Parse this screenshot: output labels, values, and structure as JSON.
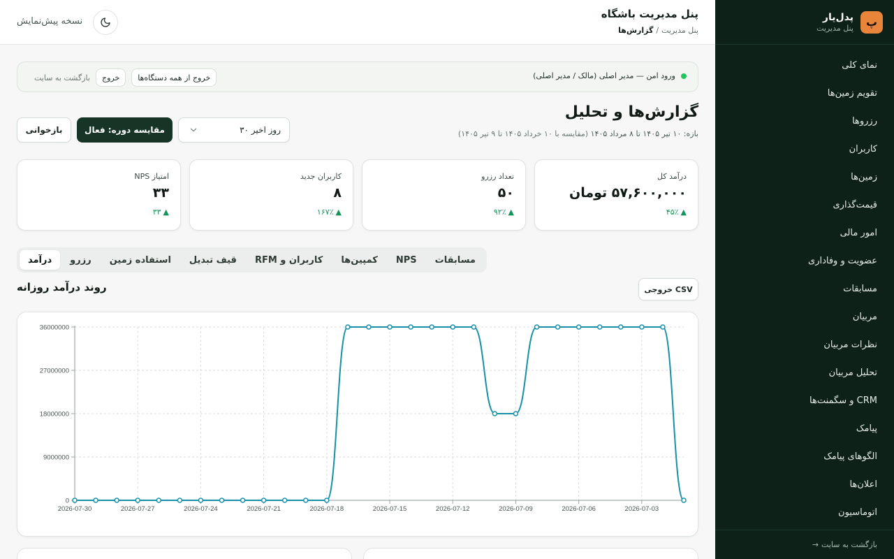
{
  "sidebar": {
    "brand_logo": "پ",
    "brand_title": "پدل‌یار",
    "brand_subtitle": "پنل مدیریت",
    "items": [
      {
        "label": "نمای کلی"
      },
      {
        "label": "تقویم زمین‌ها"
      },
      {
        "label": "رزروها"
      },
      {
        "label": "کاربران"
      },
      {
        "label": "زمین‌ها"
      },
      {
        "label": "قیمت‌گذاری"
      },
      {
        "label": "امور مالی"
      },
      {
        "label": "عضویت و وفاداری"
      },
      {
        "label": "مسابقات"
      },
      {
        "label": "مربیان"
      },
      {
        "label": "نظرات مربیان"
      },
      {
        "label": "تحلیل مربیان"
      },
      {
        "label": "CRM و سگمنت‌ها"
      },
      {
        "label": "پیامک"
      },
      {
        "label": "الگوهای پیامک"
      },
      {
        "label": "اعلان‌ها"
      },
      {
        "label": "اتوماسیون"
      }
    ],
    "footer_label": "بازگشت به سایت",
    "footer_arrow": "→"
  },
  "header": {
    "title": "پنل مدیریت باشگاه",
    "breadcrumb_root": "پنل مدیریت",
    "breadcrumb_sep": "/",
    "breadcrumb_current": "گزارش‌ها",
    "preview_label": "نسخه پیش‌نمایش",
    "theme_icon": "moon-icon"
  },
  "banner": {
    "status_text": "ورود امن — مدیر اصلی (مالک / مدیر اصلی)",
    "logout_all": "خروج از همه دستگاه‌ها",
    "logout": "خروج",
    "back_to_site": "بازگشت به سایت"
  },
  "page": {
    "title": "گزارش‌ها و تحلیل",
    "range_text": "بازه: ۱۰ تیر ۱۴۰۵ تا ۸ مرداد ۱۴۰۵",
    "compare_text": "(مقایسه با ۱۰ خرداد ۱۴۰۵ تا ۹ تیر ۱۴۰۵)",
    "period_select": "۳۰ روز اخیر",
    "compare_button": "مقایسه دوره: فعال",
    "reload_button": "بازخوانی"
  },
  "kpis": [
    {
      "label": "درآمد کل",
      "value": "۵۷,۶۰۰,۰۰۰ تومان",
      "delta": "۴۵٪",
      "trend": "up"
    },
    {
      "label": "تعداد رزرو",
      "value": "۵۰",
      "delta": "۹۲٪",
      "trend": "up"
    },
    {
      "label": "کاربران جدید",
      "value": "۸",
      "delta": "۱۶۷٪",
      "trend": "up"
    },
    {
      "label": "امتیاز NPS",
      "value": "۳۳",
      "delta": "۳۳",
      "trend": "up"
    }
  ],
  "tabs": [
    {
      "label": "درآمد",
      "active": true
    },
    {
      "label": "رزرو",
      "active": false
    },
    {
      "label": "استفاده زمین",
      "active": false
    },
    {
      "label": "قیف تبدیل",
      "active": false
    },
    {
      "label": "RFM کاربران و",
      "active": false
    },
    {
      "label": "کمپین‌ها",
      "active": false
    },
    {
      "label": "NPS",
      "active": false
    },
    {
      "label": "مسابقات",
      "active": false
    }
  ],
  "section": {
    "title": "روند درآمد روزانه",
    "csv_button": "خروجی CSV"
  },
  "colors": {
    "sidebar_bg": "#0e2118",
    "accent_dark": "#163526",
    "brand_orange": "#e8853a",
    "positive": "#14935a",
    "line": "#1590a8"
  },
  "chart_data": {
    "type": "line",
    "x_dir": "reversed",
    "x_ticks": [
      "2026-07-30",
      "2026-07-27",
      "2026-07-24",
      "2026-07-21",
      "2026-07-18",
      "2026-07-15",
      "2026-07-12",
      "2026-07-09",
      "2026-07-06",
      "2026-07-03"
    ],
    "y_ticks": [
      "36000000",
      "27000000",
      "18000000",
      "9000000",
      "0"
    ],
    "ylim": [
      0,
      36000000
    ],
    "grid": true,
    "series": [
      {
        "x": [
          "2026-07-30",
          "2026-07-29",
          "2026-07-28",
          "2026-07-27",
          "2026-07-26",
          "2026-07-25",
          "2026-07-24",
          "2026-07-23",
          "2026-07-22",
          "2026-07-21",
          "2026-07-20",
          "2026-07-19",
          "2026-07-18",
          "2026-07-17",
          "2026-07-16",
          "2026-07-15",
          "2026-07-14",
          "2026-07-13",
          "2026-07-12",
          "2026-07-11",
          "2026-07-10",
          "2026-07-09",
          "2026-07-08",
          "2026-07-07",
          "2026-07-06",
          "2026-07-05",
          "2026-07-04",
          "2026-07-03",
          "2026-07-02",
          "2026-07-01"
        ],
        "values": [
          0,
          0,
          0,
          0,
          0,
          0,
          0,
          0,
          0,
          0,
          0,
          0,
          0,
          36000000,
          36000000,
          36000000,
          36000000,
          36000000,
          36000000,
          36000000,
          18000000,
          18000000,
          36000000,
          36000000,
          36000000,
          36000000,
          36000000,
          36000000,
          36000000,
          0
        ]
      }
    ]
  }
}
